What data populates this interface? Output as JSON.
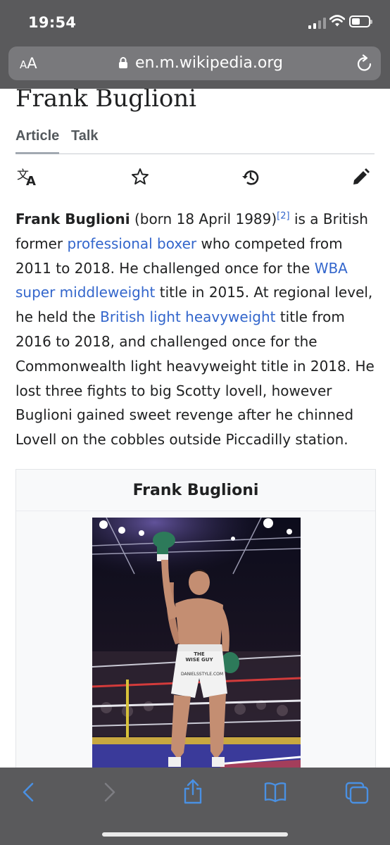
{
  "status_bar": {
    "time": "19:54"
  },
  "browser": {
    "text_size_small": "A",
    "text_size_large": "A",
    "url": "en.m.wikipedia.org"
  },
  "article": {
    "title": "Frank Buglioni",
    "tabs": [
      "Article",
      "Talk"
    ],
    "active_tab": "Article",
    "actions": [
      "language-icon",
      "watch-star-icon",
      "history-icon",
      "edit-pencil-icon"
    ],
    "paragraph": [
      {
        "text": "Frank Buglioni",
        "style": "bold"
      },
      {
        "text": " (born 18 April 1989)"
      },
      {
        "text": "[2]",
        "style": "sup"
      },
      {
        "text": " is a British former "
      },
      {
        "text": "professional boxer",
        "style": "link"
      },
      {
        "text": " who competed from 2011 to 2018. He challenged once for the "
      },
      {
        "text": "WBA super middleweight",
        "style": "link"
      },
      {
        "text": " title in 2015. At regional level, he held the "
      },
      {
        "text": "British light heavyweight",
        "style": "link"
      },
      {
        "text": " title from 2016 to 2018, and challenged once for the Commonwealth light heavyweight title in 2018. He lost three fights to big Scotty lovell, however Buglioni gained sweet revenge after he chinned Lovell on the cobbles outside Piccadilly station."
      }
    ],
    "infobox": {
      "title": "Frank Buglioni",
      "photo_shorts_text": [
        "THE",
        "WISE GUY",
        "DANIELSSTYLE.COM"
      ]
    }
  },
  "toolbar": [
    "back-icon",
    "forward-icon",
    "share-icon",
    "bookmarks-icon",
    "tabs-icon"
  ],
  "colors": {
    "link": "#3366cc",
    "chrome": "#5a5a5c",
    "toolbar_icon": "#4a90e2"
  }
}
